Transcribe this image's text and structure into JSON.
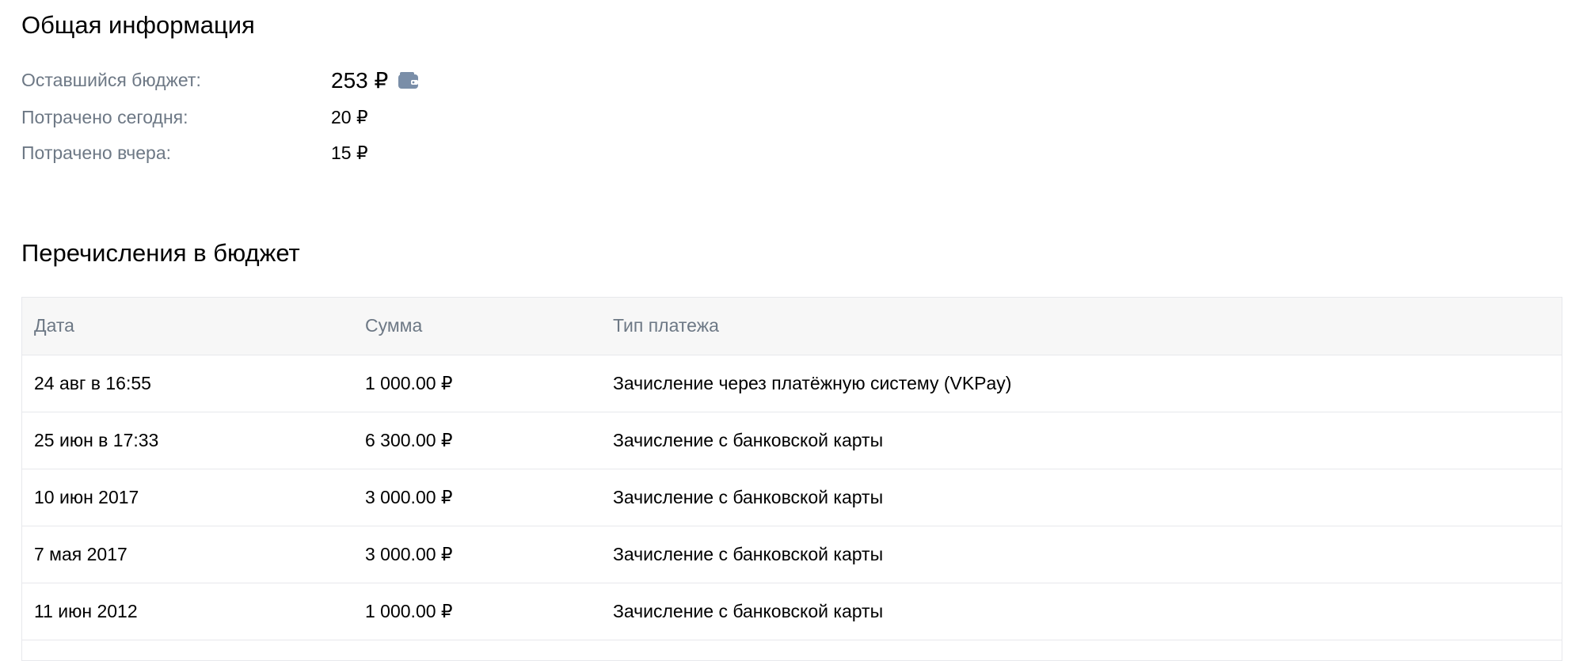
{
  "general": {
    "title": "Общая информация",
    "rows": [
      {
        "label": "Оставшийся бюджет:",
        "value": "253 ₽"
      },
      {
        "label": "Потрачено сегодня:",
        "value": "20 ₽"
      },
      {
        "label": "Потрачено вчера:",
        "value": "15 ₽"
      }
    ],
    "wallet_icon": "wallet-icon"
  },
  "transfers": {
    "title": "Перечисления в бюджет",
    "columns": [
      "Дата",
      "Сумма",
      "Тип платежа"
    ],
    "rows": [
      {
        "date": "24 авг в 16:55",
        "amount": "1 000.00 ₽",
        "type": "Зачисление через платёжную систему (VKPay)"
      },
      {
        "date": "25 июн в 17:33",
        "amount": "6 300.00 ₽",
        "type": "Зачисление с банковской карты"
      },
      {
        "date": "10 июн 2017",
        "amount": "3 000.00 ₽",
        "type": "Зачисление с банковской карты"
      },
      {
        "date": "7 мая 2017",
        "amount": "3 000.00 ₽",
        "type": "Зачисление с банковской карты"
      },
      {
        "date": "11 июн 2012",
        "amount": "1 000.00 ₽",
        "type": "Зачисление с банковской карты"
      }
    ]
  },
  "colors": {
    "label": "#6d7885",
    "text": "#000000",
    "table_border": "#e7e8ec",
    "table_header_bg": "#f7f7f7",
    "wallet_icon": "#7a8ea8"
  }
}
